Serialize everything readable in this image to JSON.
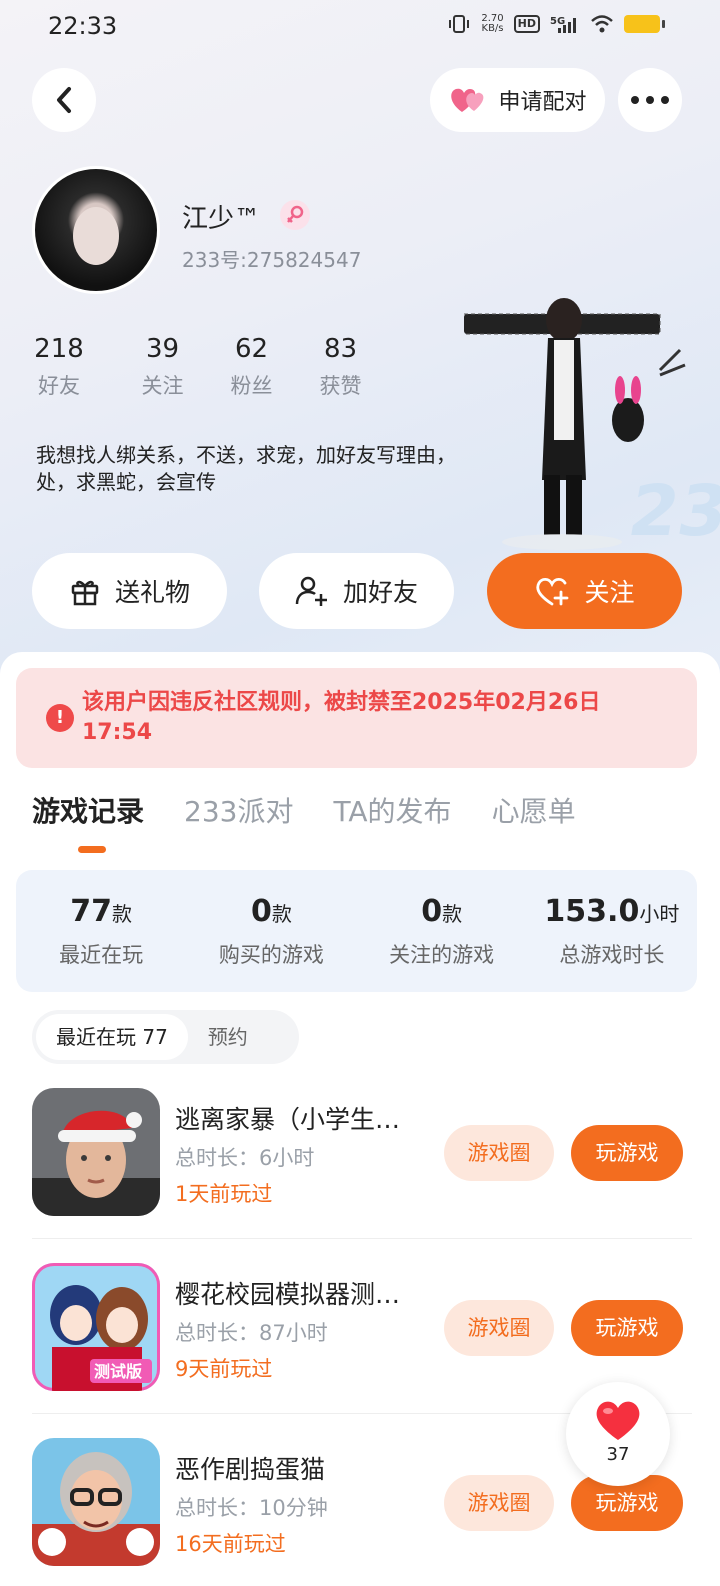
{
  "status_bar": {
    "time": "22:33",
    "net_speed_top": "2.70",
    "net_speed_bottom": "KB/s",
    "hd": "HD",
    "network": "5G"
  },
  "header": {
    "pair_label": "申请配对",
    "more_icon": "more-dots-icon"
  },
  "profile": {
    "name": "江少™",
    "uid": "233号:275824547",
    "stats": [
      {
        "value": "218",
        "label": "好友"
      },
      {
        "value": "39",
        "label": "关注"
      },
      {
        "value": "62",
        "label": "粉丝"
      },
      {
        "value": "83",
        "label": "获赞"
      }
    ],
    "bio": "我想找人绑关系，不送，求宠，加好友写理由，处，求黑蛇，会宣传"
  },
  "actions": {
    "gift": "送礼物",
    "add_friend": "加好友",
    "follow": "关注"
  },
  "ban_notice": "该用户因违反社区规则，被封禁至2025年02月26日 17:54",
  "tabs": [
    {
      "label": "游戏记录"
    },
    {
      "label": "233派对"
    },
    {
      "label": "TA的发布"
    },
    {
      "label": "心愿单"
    }
  ],
  "game_stats": [
    {
      "value": "77",
      "unit": "款",
      "label": "最近在玩"
    },
    {
      "value": "0",
      "unit": "款",
      "label": "购买的游戏"
    },
    {
      "value": "0",
      "unit": "款",
      "label": "关注的游戏"
    },
    {
      "value": "153.0",
      "unit": "小时",
      "label": "总游戏时长"
    }
  ],
  "filters": {
    "recent": "最近在玩 77",
    "reserve": "预约"
  },
  "games": [
    {
      "name": "逃离家暴（小学生…",
      "duration": "总时长：6小时",
      "last_played": "1天前玩过",
      "circle": "游戏圈",
      "play": "玩游戏"
    },
    {
      "name": "樱花校园模拟器测…",
      "duration": "总时长：87小时",
      "last_played": "9天前玩过",
      "circle": "游戏圈",
      "play": "玩游戏"
    },
    {
      "name": "恶作剧捣蛋猫",
      "duration": "总时长：10分钟",
      "last_played": "16天前玩过",
      "circle": "游戏圈",
      "play": "玩游戏"
    }
  ],
  "like_float": {
    "count": "37"
  },
  "colors": {
    "accent": "#f36d1f",
    "ban_red": "#ec4848",
    "ban_bg": "#fbe3e3"
  }
}
